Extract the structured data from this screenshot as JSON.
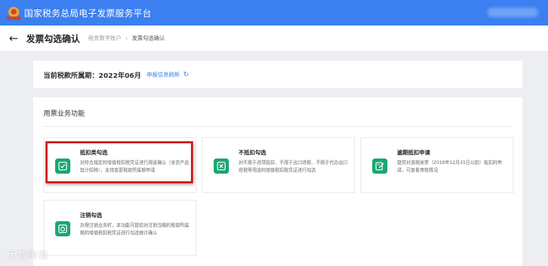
{
  "topbar": {
    "title": "国家税务总局电子发票服务平台"
  },
  "header": {
    "back_icon": "←",
    "title": "发票勾选确认",
    "breadcrumb_root": "税务数字账户",
    "breadcrumb_sep": "›",
    "breadcrumb_current": "发票勾选确认"
  },
  "period": {
    "label": "当前税款所属期：2022年06月",
    "refresh_link": "申报信息刷新",
    "refresh_icon": "↻"
  },
  "functions": {
    "title": "用票业务功能",
    "cards": [
      {
        "title": "抵扣类勾选",
        "desc": "对符合规定的增值税扣税凭证进行用途确认（含农产品加计扣除），支持变更税款所属期申请",
        "icon": "invoice-check-icon"
      },
      {
        "title": "不抵扣勾选",
        "desc": "对不用于进项抵扣、不用于出口退税、不用于代办出口退税等用途的增值税扣税凭证进行勾选",
        "icon": "invoice-cross-icon"
      },
      {
        "title": "逾期抵扣申请",
        "desc": "提供对逾期发票（2016年12月31日以前）抵扣的申请，可查看审核情况",
        "icon": "edit-form-icon"
      },
      {
        "title": "注销勾选",
        "desc": "办理注销业务时，本功能可提前对注销当期的税款所属期的增值税扣税凭证进行勾选统计确认",
        "icon": "cancel-check-icon"
      }
    ]
  },
  "watermark": "大数跨境",
  "colors": {
    "brand_blue": "#3b7ff0",
    "card_icon_green": "#1aa772",
    "highlight_red": "#d0191c"
  }
}
